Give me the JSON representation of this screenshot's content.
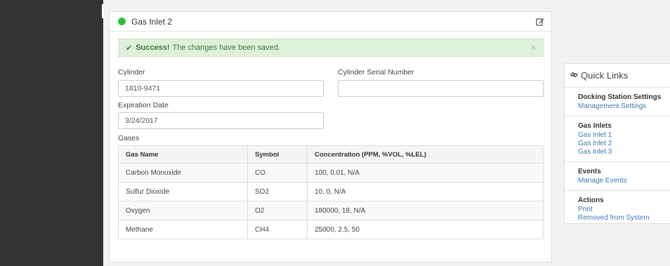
{
  "panel": {
    "title": "Gas Inlet 2",
    "status_color": "#2fbf3a",
    "edit_icon": "edit-icon"
  },
  "alert": {
    "strong": "Success!",
    "message": "The changes have been saved.",
    "close": "×"
  },
  "form": {
    "cylinder_label": "Cylinder",
    "cylinder_value": "1810-9471",
    "serial_label": "Cylinder Serial Number",
    "serial_value": "",
    "expiration_label": "Expiration Date",
    "expiration_value": "3/24/2017",
    "gases_label": "Gases"
  },
  "gases_table": {
    "headers": [
      "Gas Name",
      "Symbol",
      "Concentration (PPM, %VOL, %LEL)"
    ],
    "rows": [
      [
        "Carbon Monoxide",
        "CO",
        "100, 0.01, N/A"
      ],
      [
        "Sulfur Dioxide",
        "SO2",
        "10, 0, N/A"
      ],
      [
        "Oxygen",
        "O2",
        "180000, 18, N/A"
      ],
      [
        "Methane",
        "CH4",
        "25000, 2.5, 50"
      ]
    ]
  },
  "quick_links": {
    "title": "Quick Links",
    "sections": [
      {
        "heading": "Docking Station Settings",
        "links": [
          "Management Settings"
        ]
      },
      {
        "heading": "Gas Inlets",
        "links": [
          "Gas Inlet 1",
          "Gas Inlet 2",
          "Gas Inlet 3"
        ]
      },
      {
        "heading": "Events",
        "links": [
          "Manage Events"
        ]
      },
      {
        "heading": "Actions",
        "links": [
          "Print",
          "Removed from System"
        ]
      }
    ]
  },
  "colors": {
    "sidebar": "#333333",
    "alert_bg": "#dff0d8",
    "alert_text": "#3c763d",
    "link": "#3a7ab8"
  }
}
